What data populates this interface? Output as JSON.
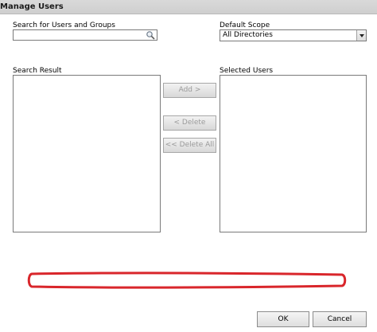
{
  "window": {
    "title": "Manage Users"
  },
  "search": {
    "label": "Search for Users and Groups",
    "value": "",
    "placeholder": "",
    "icon": "search-icon"
  },
  "scope": {
    "label": "Default Scope",
    "selected": "All Directories"
  },
  "search_result": {
    "label": "Search Result",
    "items": []
  },
  "selected_users": {
    "label": "Selected Users",
    "items": []
  },
  "actions": {
    "add_label": "Add >",
    "delete_label": "< Delete",
    "delete_all_label": "<< Delete All"
  },
  "footer": {
    "ok_label": "OK",
    "cancel_label": "Cancel"
  },
  "annotation": {
    "highlight_color": "#d9262b"
  }
}
